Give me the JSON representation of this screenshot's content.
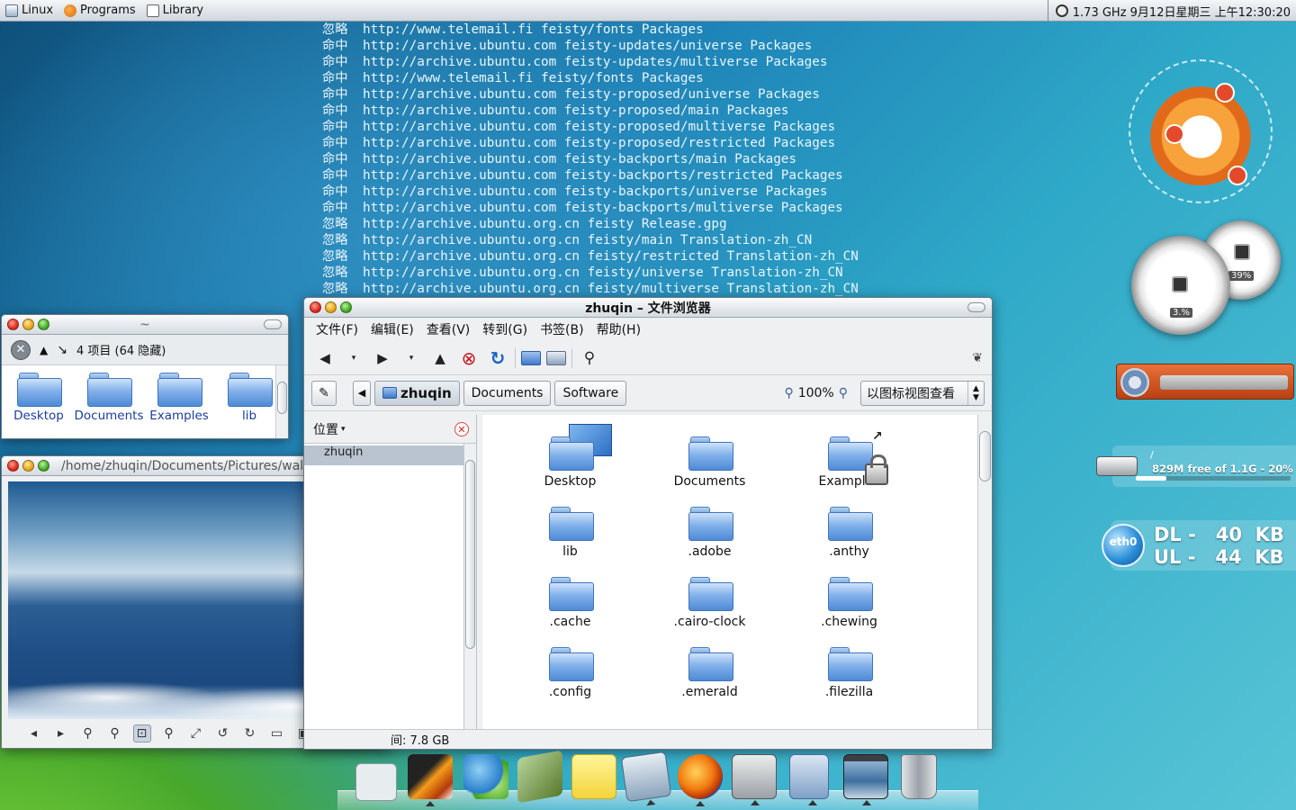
{
  "top_panel": {
    "menus": [
      "Linux",
      "Programs",
      "Library"
    ],
    "status": "1.73 GHz 9月12日星期三 上午12:30:20"
  },
  "terminal": {
    "lines": [
      {
        "status": "忽略",
        "text": "http://www.telemail.fi feisty/fonts Packages"
      },
      {
        "status": "命中",
        "text": "http://archive.ubuntu.com feisty-updates/universe Packages"
      },
      {
        "status": "命中",
        "text": "http://archive.ubuntu.com feisty-updates/multiverse Packages"
      },
      {
        "status": "命中",
        "text": "http://www.telemail.fi feisty/fonts Packages"
      },
      {
        "status": "命中",
        "text": "http://archive.ubuntu.com feisty-proposed/universe Packages"
      },
      {
        "status": "命中",
        "text": "http://archive.ubuntu.com feisty-proposed/main Packages"
      },
      {
        "status": "命中",
        "text": "http://archive.ubuntu.com feisty-proposed/multiverse Packages"
      },
      {
        "status": "命中",
        "text": "http://archive.ubuntu.com feisty-proposed/restricted Packages"
      },
      {
        "status": "命中",
        "text": "http://archive.ubuntu.com feisty-backports/main Packages"
      },
      {
        "status": "命中",
        "text": "http://archive.ubuntu.com feisty-backports/restricted Packages"
      },
      {
        "status": "命中",
        "text": "http://archive.ubuntu.com feisty-backports/universe Packages"
      },
      {
        "status": "命中",
        "text": "http://archive.ubuntu.com feisty-backports/multiverse Packages"
      },
      {
        "status": "忽略",
        "text": "http://archive.ubuntu.org.cn feisty Release.gpg"
      },
      {
        "status": "忽略",
        "text": "http://archive.ubuntu.org.cn feisty/main Translation-zh_CN"
      },
      {
        "status": "忽略",
        "text": "http://archive.ubuntu.org.cn feisty/restricted Translation-zh_CN"
      },
      {
        "status": "忽略",
        "text": "http://archive.ubuntu.org.cn feisty/universe Translation-zh_CN"
      },
      {
        "status": "忽略",
        "text": "http://archive.ubuntu.org.cn feisty/multiverse Translation-zh_CN"
      }
    ]
  },
  "small_folder": {
    "title": "~",
    "summary": "4 项目 (64 隐藏)",
    "items": [
      "Desktop",
      "Documents",
      "Examples",
      "lib"
    ]
  },
  "image_viewer": {
    "title": "/home/zhuqin/Documents/Pictures/wallpa..."
  },
  "browser": {
    "title": "zhuqin – 文件浏览器",
    "menus": [
      "文件(F)",
      "编辑(E)",
      "查看(V)",
      "转到(G)",
      "书签(B)",
      "帮助(H)"
    ],
    "breadcrumbs": [
      "zhuqin",
      "Documents",
      "Software"
    ],
    "zoom": "100%",
    "view_mode": "以图标视图查看",
    "sidepane_title": "位置",
    "tree_item": "zhuqin",
    "items": [
      "Desktop",
      "Documents",
      "Examples",
      "lib",
      ".adobe",
      ".anthy",
      ".cache",
      ".cairo-clock",
      ".chewing",
      ".config",
      ".emerald",
      ".filezilla"
    ],
    "status_free": "间: 7.8 GB"
  },
  "widgets": {
    "gauge_big_label": "3.%",
    "gauge_small_label": "39%",
    "disk_mount": "/",
    "disk_text": "829M free of 1.1G - 20%",
    "disk_used_fraction": 0.2,
    "net_iface": "eth0",
    "net_dl": "DL -   40  KB",
    "net_ul": "UL -   44  KB"
  },
  "dock": {
    "apps": [
      "workspace-switcher",
      "matlab",
      "messenger",
      "library-books",
      "sticky-notes",
      "photo-viewer",
      "firefox",
      "terminal",
      "file-cabinet",
      "image-viewer",
      "trash"
    ]
  }
}
